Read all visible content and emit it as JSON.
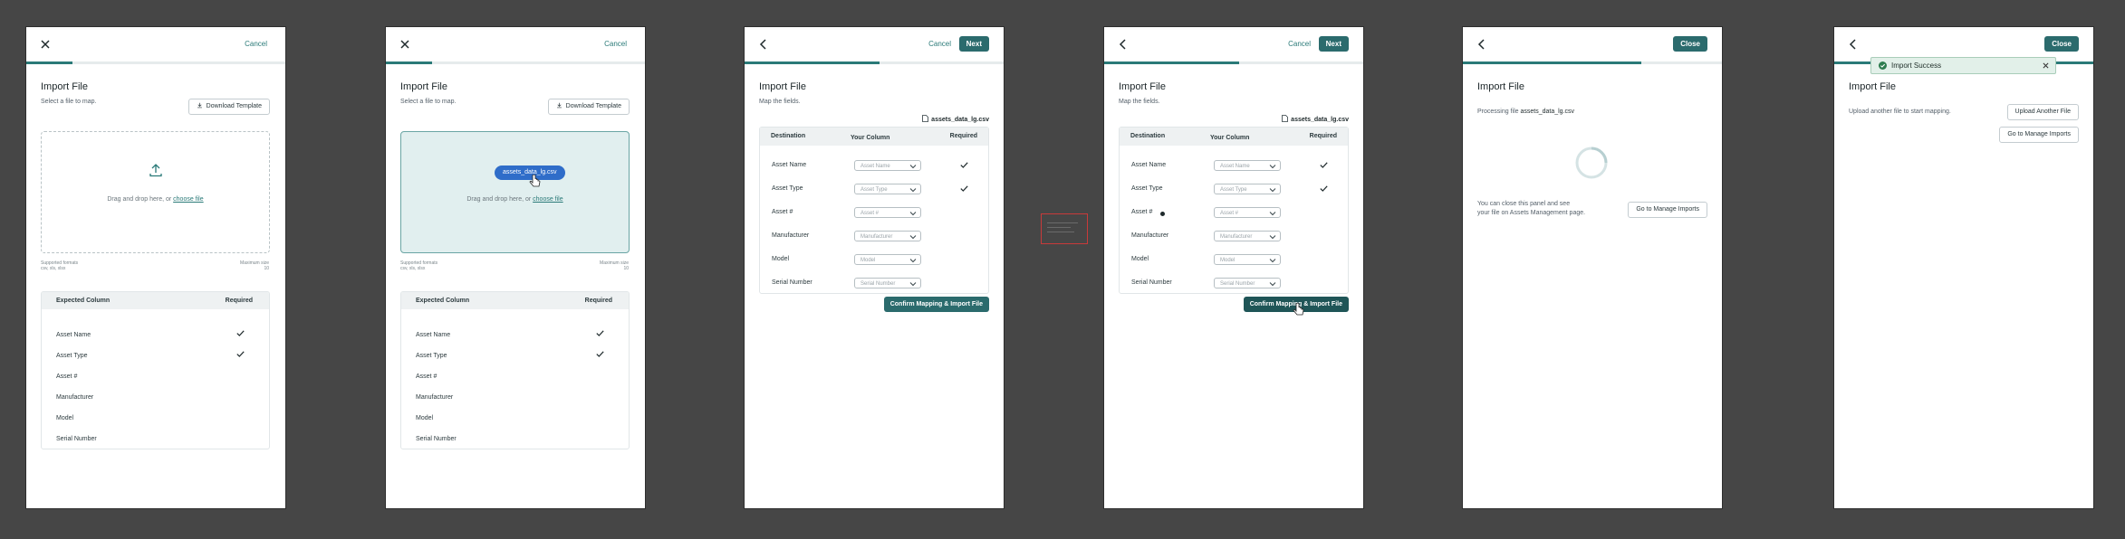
{
  "common": {
    "title": "Import File",
    "cancel": "Cancel",
    "next": "Next",
    "close": "Close",
    "select_sub": "Select a file to map.",
    "download_template": "Download Template",
    "drag_text": "Drag and drop here, or",
    "choose_file": "choose file",
    "supported_label": "Supported formats",
    "supported_value": "csv, xls, xlsx",
    "max_label": "Maximum size",
    "max_value": "10",
    "expected_col": "Expected Column",
    "required": "Required",
    "map_sub": "Map the fields.",
    "file_name": "assets_data_lg.csv",
    "destination": "Destination",
    "your_column": "Your Column",
    "confirm": "Confirm Mapping & Import File",
    "processing_prefix": "Processing file",
    "close_info_1": "You can close this panel and see",
    "close_info_2": "your file on Assets Management page.",
    "go_manage": "Go to Manage Imports",
    "upload_another_sub": "Upload another file to start mapping.",
    "upload_another": "Upload Another File",
    "toast": "Import Success"
  },
  "fields": [
    {
      "name": "Asset Name",
      "placeholder": "Asset Name",
      "required": true
    },
    {
      "name": "Asset Type",
      "placeholder": "Asset Type",
      "required": true
    },
    {
      "name": "Asset #",
      "placeholder": "Asset #",
      "required": false
    },
    {
      "name": "Manufacturer",
      "placeholder": "Manufacturer",
      "required": false
    },
    {
      "name": "Model",
      "placeholder": "Model",
      "required": false
    },
    {
      "name": "Serial Number",
      "placeholder": "Serial Number",
      "required": false
    }
  ],
  "dragged_file": "assets_data_lg.csv",
  "progress": {
    "p1": 0.18,
    "p2": 0.18,
    "p3": 0.52,
    "p4": 0.52,
    "p5": 0.69,
    "p6": 1.0
  },
  "colors": {
    "accent": "#2a7a78",
    "button": "#2b6b6d",
    "chip": "#2f6dc9"
  }
}
